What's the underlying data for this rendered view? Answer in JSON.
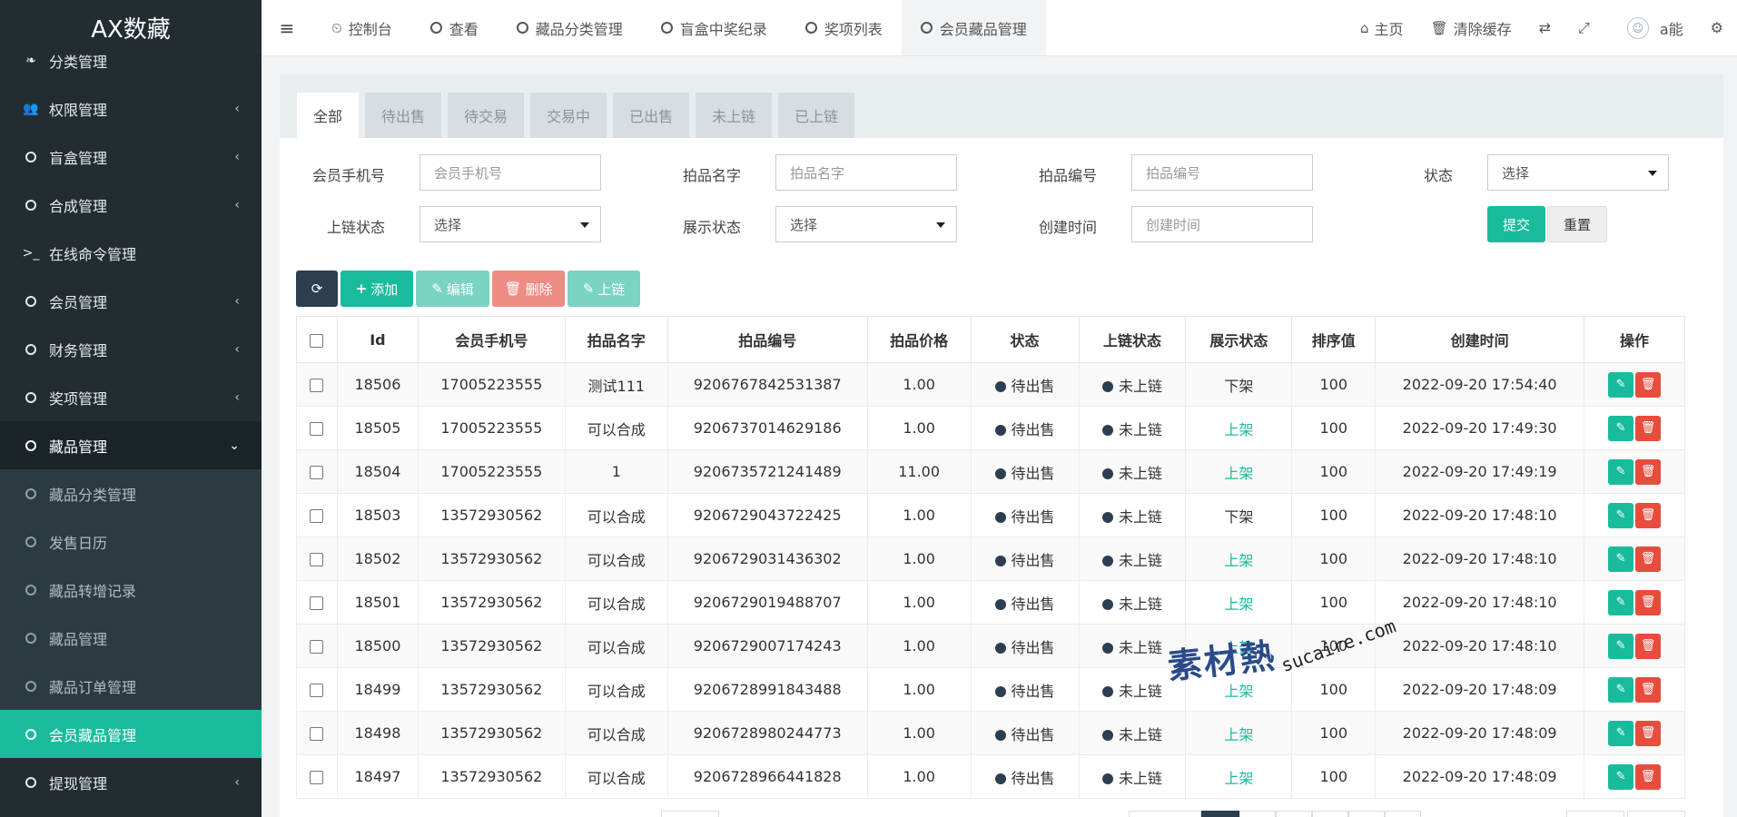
{
  "app": {
    "logo": "AX数藏"
  },
  "sidebar": {
    "items": [
      {
        "label": "分类管理",
        "icon": "leaf-icon"
      },
      {
        "label": "权限管理",
        "icon": "users-icon"
      },
      {
        "label": "盲盒管理",
        "icon": "circle-icon"
      },
      {
        "label": "合成管理",
        "icon": "circle-icon"
      },
      {
        "label": "在线命令管理",
        "icon": "terminal-icon"
      },
      {
        "label": "会员管理",
        "icon": "circle-icon"
      },
      {
        "label": "财务管理",
        "icon": "circle-icon"
      },
      {
        "label": "奖项管理",
        "icon": "circle-icon"
      },
      {
        "label": "藏品管理",
        "icon": "circle-icon"
      }
    ],
    "submenu": [
      {
        "label": "藏品分类管理"
      },
      {
        "label": "发售日历"
      },
      {
        "label": "藏品转增记录"
      },
      {
        "label": "藏品管理"
      },
      {
        "label": "藏品订单管理"
      },
      {
        "label": "会员藏品管理"
      }
    ],
    "bottom_item": {
      "label": "提现管理"
    }
  },
  "topbar": {
    "tabs": [
      {
        "label": "控制台",
        "icon": "dashboard-icon"
      },
      {
        "label": "查看"
      },
      {
        "label": "藏品分类管理"
      },
      {
        "label": "盲盒中奖纪录"
      },
      {
        "label": "奖项列表"
      },
      {
        "label": "会员藏品管理"
      }
    ],
    "home": "主页",
    "clear_cache": "清除缓存",
    "username": "a能"
  },
  "filter_tabs": [
    "全部",
    "待出售",
    "待交易",
    "交易中",
    "已出售",
    "未上链",
    "已上链"
  ],
  "form": {
    "phone": {
      "label": "会员手机号",
      "placeholder": "会员手机号"
    },
    "name": {
      "label": "拍品名字",
      "placeholder": "拍品名字"
    },
    "code": {
      "label": "拍品编号",
      "placeholder": "拍品编号"
    },
    "status": {
      "label": "状态",
      "value": "选择"
    },
    "chain_status": {
      "label": "上链状态",
      "value": "选择"
    },
    "display_status": {
      "label": "展示状态",
      "value": "选择"
    },
    "created": {
      "label": "创建时间",
      "placeholder": "创建时间"
    },
    "submit": "提交",
    "reset": "重置"
  },
  "toolbar": {
    "add": "添加",
    "edit": "编辑",
    "delete": "删除",
    "chain": "上链"
  },
  "table": {
    "headers": [
      "Id",
      "会员手机号",
      "拍品名字",
      "拍品编号",
      "拍品价格",
      "状态",
      "上链状态",
      "展示状态",
      "排序值",
      "创建时间",
      "操作"
    ],
    "rows": [
      {
        "id": "18506",
        "phone": "17005223555",
        "name": "测试111",
        "code": "9206767842531387",
        "price": "1.00",
        "status": "待出售",
        "chain": "未上链",
        "display": "下架",
        "sort": "100",
        "created": "2022-09-20 17:54:40"
      },
      {
        "id": "18505",
        "phone": "17005223555",
        "name": "可以合成",
        "code": "9206737014629186",
        "price": "1.00",
        "status": "待出售",
        "chain": "未上链",
        "display": "上架",
        "sort": "100",
        "created": "2022-09-20 17:49:30"
      },
      {
        "id": "18504",
        "phone": "17005223555",
        "name": "1",
        "code": "9206735721241489",
        "price": "11.00",
        "status": "待出售",
        "chain": "未上链",
        "display": "上架",
        "sort": "100",
        "created": "2022-09-20 17:49:19"
      },
      {
        "id": "18503",
        "phone": "13572930562",
        "name": "可以合成",
        "code": "9206729043722425",
        "price": "1.00",
        "status": "待出售",
        "chain": "未上链",
        "display": "下架",
        "sort": "100",
        "created": "2022-09-20 17:48:10"
      },
      {
        "id": "18502",
        "phone": "13572930562",
        "name": "可以合成",
        "code": "9206729031436302",
        "price": "1.00",
        "status": "待出售",
        "chain": "未上链",
        "display": "上架",
        "sort": "100",
        "created": "2022-09-20 17:48:10"
      },
      {
        "id": "18501",
        "phone": "13572930562",
        "name": "可以合成",
        "code": "9206729019488707",
        "price": "1.00",
        "status": "待出售",
        "chain": "未上链",
        "display": "上架",
        "sort": "100",
        "created": "2022-09-20 17:48:10"
      },
      {
        "id": "18500",
        "phone": "13572930562",
        "name": "可以合成",
        "code": "9206729007174243",
        "price": "1.00",
        "status": "待出售",
        "chain": "未上链",
        "display": "上架",
        "sort": "100",
        "created": "2022-09-20 17:48:10"
      },
      {
        "id": "18499",
        "phone": "13572930562",
        "name": "可以合成",
        "code": "9206728991843488",
        "price": "1.00",
        "status": "待出售",
        "chain": "未上链",
        "display": "上架",
        "sort": "100",
        "created": "2022-09-20 17:48:09"
      },
      {
        "id": "18498",
        "phone": "13572930562",
        "name": "可以合成",
        "code": "9206728980244773",
        "price": "1.00",
        "status": "待出售",
        "chain": "未上链",
        "display": "上架",
        "sort": "100",
        "created": "2022-09-20 17:48:09"
      },
      {
        "id": "18497",
        "phone": "13572930562",
        "name": "可以合成",
        "code": "9206728966441828",
        "price": "1.00",
        "status": "待出售",
        "chain": "未上链",
        "display": "上架",
        "sort": "100",
        "created": "2022-09-20 17:48:09"
      }
    ]
  },
  "watermark": {
    "cn": "素材熱",
    "en": "sucaire.com"
  },
  "colors": {
    "sidebar": "#222d32",
    "accent": "#18bc9c",
    "danger": "#e74c3c",
    "dark": "#2c3e50"
  }
}
